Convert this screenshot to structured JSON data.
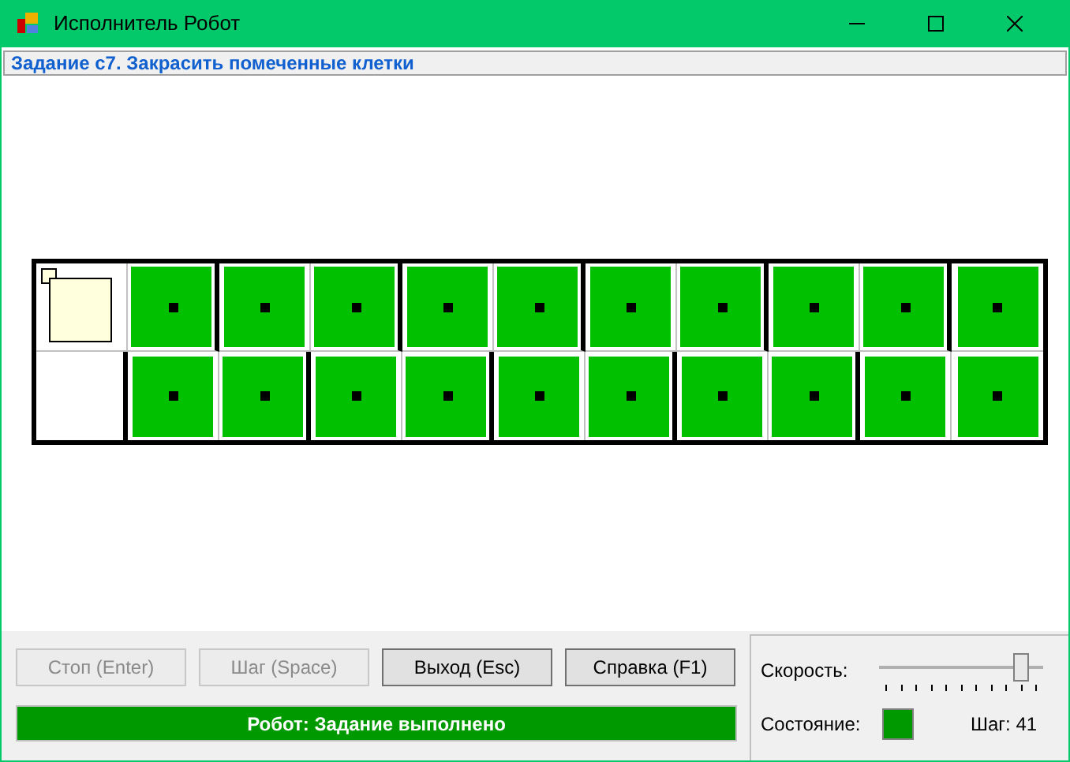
{
  "window": {
    "title": "Исполнитель Робот"
  },
  "task": "Задание с7. Закрасить помеченные клетки",
  "field": {
    "rows": [
      [
        {
          "painted": false,
          "marked": false,
          "robot": true,
          "wall_right": false
        },
        {
          "painted": true,
          "marked": true,
          "robot": false,
          "wall_right": true
        },
        {
          "painted": true,
          "marked": true,
          "robot": false,
          "wall_right": false
        },
        {
          "painted": true,
          "marked": true,
          "robot": false,
          "wall_right": true
        },
        {
          "painted": true,
          "marked": true,
          "robot": false,
          "wall_right": false
        },
        {
          "painted": true,
          "marked": true,
          "robot": false,
          "wall_right": true
        },
        {
          "painted": true,
          "marked": true,
          "robot": false,
          "wall_right": false
        },
        {
          "painted": true,
          "marked": true,
          "robot": false,
          "wall_right": true
        },
        {
          "painted": true,
          "marked": true,
          "robot": false,
          "wall_right": false
        },
        {
          "painted": true,
          "marked": true,
          "robot": false,
          "wall_right": true
        },
        {
          "painted": true,
          "marked": true,
          "robot": false
        }
      ],
      [
        {
          "painted": false,
          "marked": false,
          "robot": false,
          "wall_right": true
        },
        {
          "painted": true,
          "marked": true,
          "robot": false,
          "wall_right": false
        },
        {
          "painted": true,
          "marked": true,
          "robot": false,
          "wall_right": true
        },
        {
          "painted": true,
          "marked": true,
          "robot": false,
          "wall_right": false
        },
        {
          "painted": true,
          "marked": true,
          "robot": false,
          "wall_right": true
        },
        {
          "painted": true,
          "marked": true,
          "robot": false,
          "wall_right": false
        },
        {
          "painted": true,
          "marked": true,
          "robot": false,
          "wall_right": true
        },
        {
          "painted": true,
          "marked": true,
          "robot": false,
          "wall_right": false
        },
        {
          "painted": true,
          "marked": true,
          "robot": false,
          "wall_right": true
        },
        {
          "painted": true,
          "marked": true,
          "robot": false,
          "wall_right": false
        },
        {
          "painted": true,
          "marked": true,
          "robot": false
        }
      ]
    ]
  },
  "buttons": [
    {
      "label": "Стоп (Enter)",
      "disabled": true
    },
    {
      "label": "Шаг (Space)",
      "disabled": true
    },
    {
      "label": "Выход (Esc)",
      "disabled": false
    },
    {
      "label": "Справка (F1)",
      "disabled": false
    }
  ],
  "status_message": "Робот: Задание выполнено",
  "speed": {
    "label": "Скорость:",
    "level": 0.9
  },
  "state": {
    "label": "Состояние:",
    "color": "#009900"
  },
  "step": "Шаг: 41"
}
